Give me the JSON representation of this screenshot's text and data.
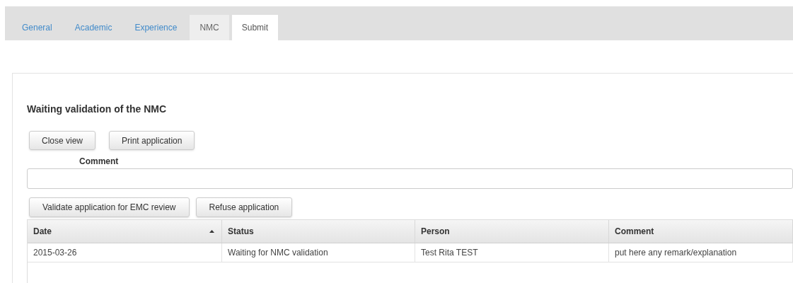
{
  "tabs": [
    {
      "label": "General",
      "selected": false,
      "disabled": false
    },
    {
      "label": "Academic",
      "selected": false,
      "disabled": false
    },
    {
      "label": "Experience",
      "selected": false,
      "disabled": false
    },
    {
      "label": "NMC",
      "selected": false,
      "disabled": true
    },
    {
      "label": "Submit",
      "selected": true,
      "disabled": false
    }
  ],
  "title": "Waiting validation of the NMC",
  "top_buttons": [
    "Close view",
    "Print application"
  ],
  "comment": {
    "label": "Comment"
  },
  "action_buttons": [
    "Validate application for EMC review",
    "Refuse application"
  ],
  "table": {
    "columns": [
      {
        "label": "Date",
        "sorted": true
      },
      {
        "label": "Status",
        "sorted": false
      },
      {
        "label": "Person",
        "sorted": false
      },
      {
        "label": "Comment",
        "sorted": false
      }
    ],
    "rows": [
      [
        "2015-03-26",
        "Waiting for NMC validation",
        "Test Rita TEST",
        "put here any remark/explanation"
      ]
    ]
  }
}
